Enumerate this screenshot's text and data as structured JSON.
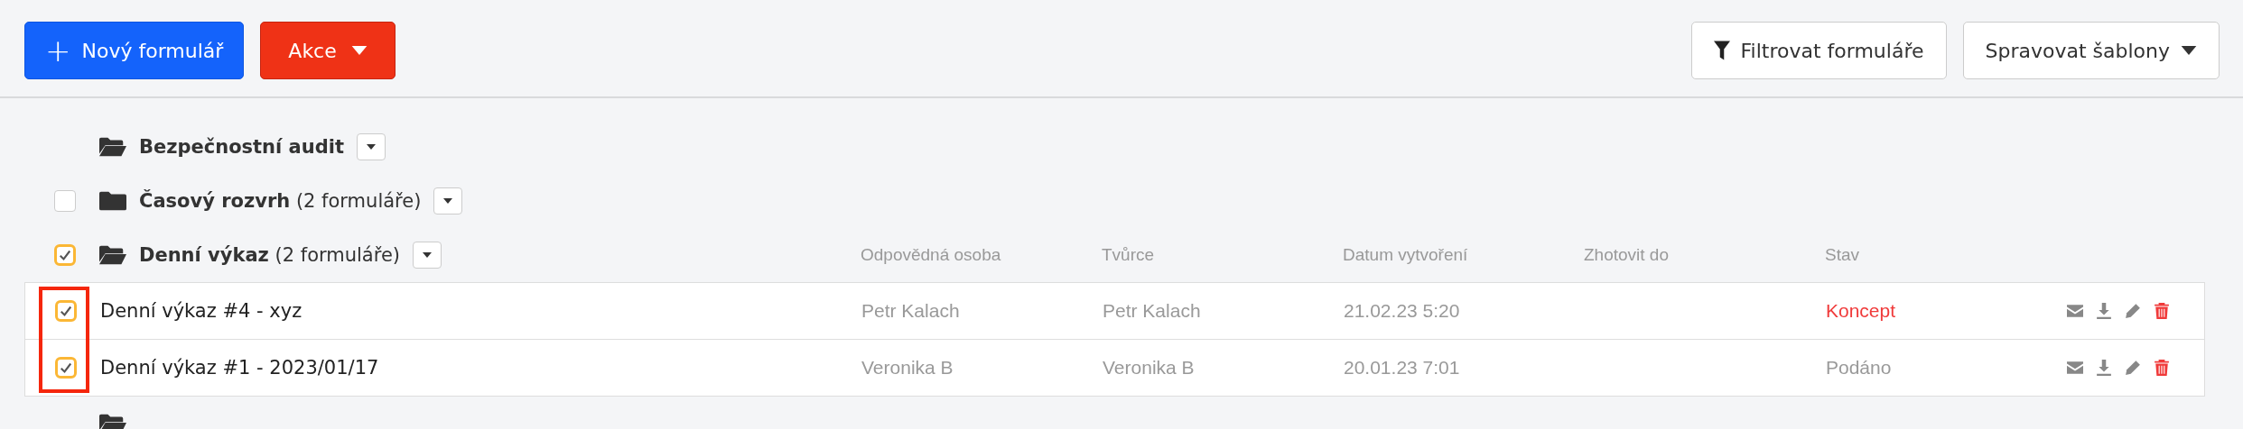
{
  "toolbar": {
    "new_button": {
      "icon": "+",
      "label": "Nový formulář"
    },
    "actions_button": {
      "label": "Akce"
    },
    "filter_button": {
      "label": "Filtrovat formuláře"
    },
    "templates_button": {
      "label": "Spravovat šablony"
    }
  },
  "groups": [
    {
      "name": "Bezpečnostní audit",
      "expanded": true
    },
    {
      "name": "Časový rozvrh",
      "count": "(2 formuláře)",
      "expanded": false,
      "checked": false
    },
    {
      "name": "Denní výkaz",
      "count": "(2 formuláře)",
      "expanded": true,
      "checked": true,
      "rows_highlighted": true,
      "columns": [
        "Odpovědná osoba",
        "Tvůrce",
        "Datum vytvoření",
        "Zhotovit do",
        "Stav"
      ],
      "rows": [
        {
          "checked": true,
          "name": "Denní výkaz #4 - xyz",
          "owner": "Petr Kalach",
          "creator": "Petr Kalach",
          "created": "21.02.23 5:20",
          "status": "Koncept",
          "draft": true
        },
        {
          "checked": true,
          "name": "Denní výkaz #1 - 2023/01/17",
          "owner": "Veronika B",
          "creator": "Veronika B",
          "created": "20.01.23 7:01",
          "status": "Podáno",
          "draft": false
        }
      ]
    }
  ]
}
